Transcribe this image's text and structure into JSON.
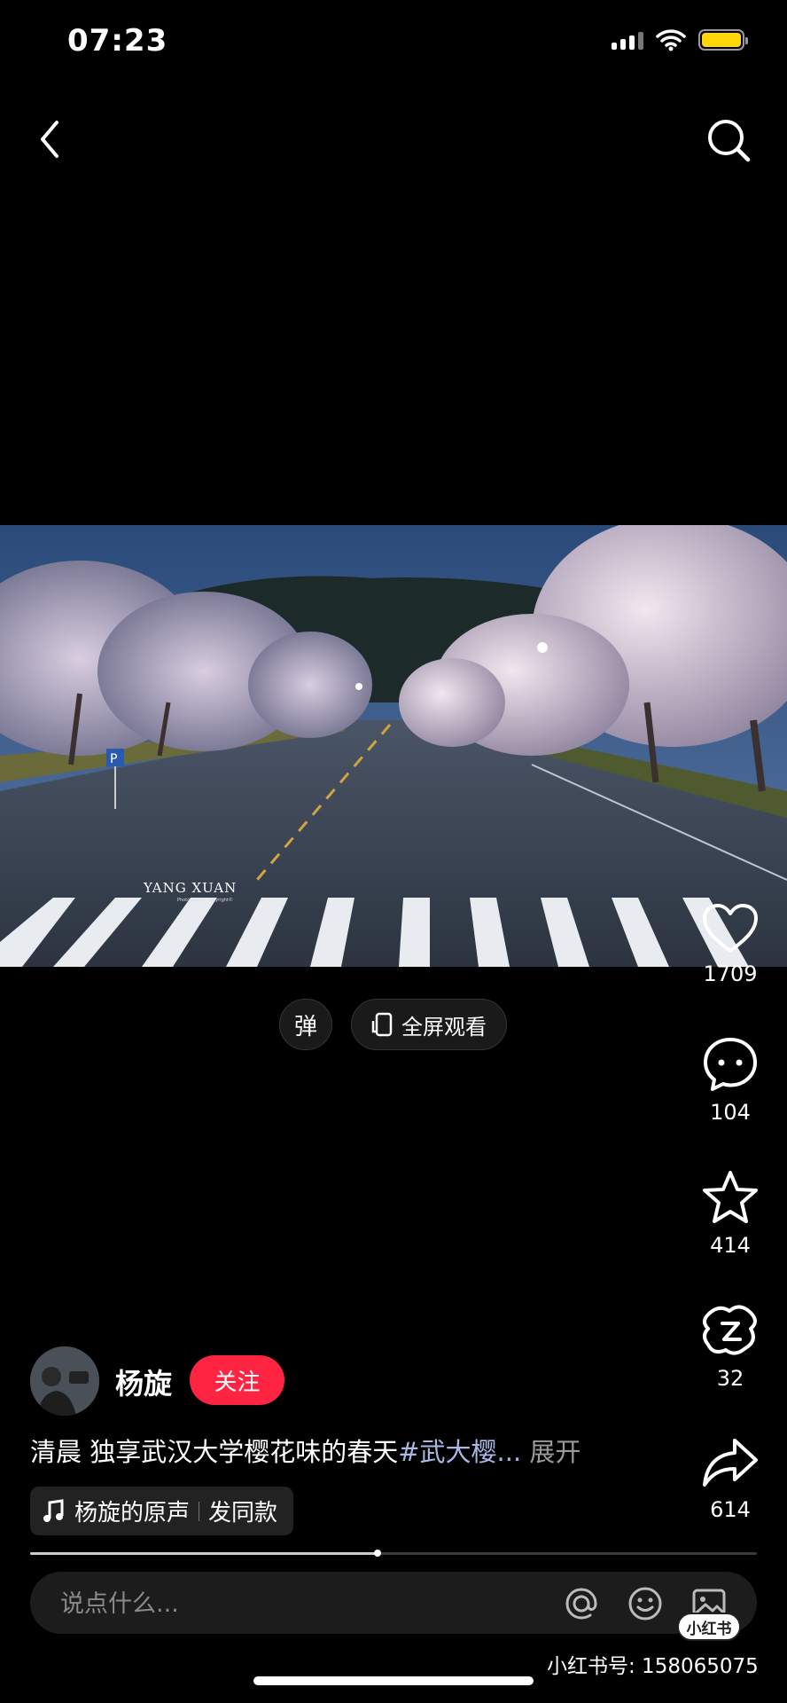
{
  "status_bar": {
    "time": "07:23",
    "battery_color": "#ffd60a"
  },
  "nav": {
    "back_icon": "chevron-left-icon",
    "search_icon": "search-icon"
  },
  "video": {
    "watermark": "YANG XUAN",
    "watermark_sub": "Photography Copyright©",
    "progress": 0.478
  },
  "controls": {
    "danmu_label": "弹",
    "fullscreen_label": "全屏观看"
  },
  "actions": {
    "like_count": "1709",
    "comment_count": "104",
    "collect_count": "414",
    "remix_count": "32",
    "share_count": "614"
  },
  "author": {
    "name": "杨旋",
    "follow_label": "关注"
  },
  "caption": {
    "text": "清晨 独享武汉大学樱花味的春天",
    "hashtag": "#武大樱...",
    "expand": " 展开"
  },
  "music": {
    "title": "杨旋的原声",
    "action": "发同款"
  },
  "comment": {
    "placeholder": "说点什么..."
  },
  "footer": {
    "badge": "小红书",
    "id_text": "小红书号: 158065075"
  },
  "colors": {
    "accent": "#ff2442",
    "hashtag": "#aab8e6"
  }
}
